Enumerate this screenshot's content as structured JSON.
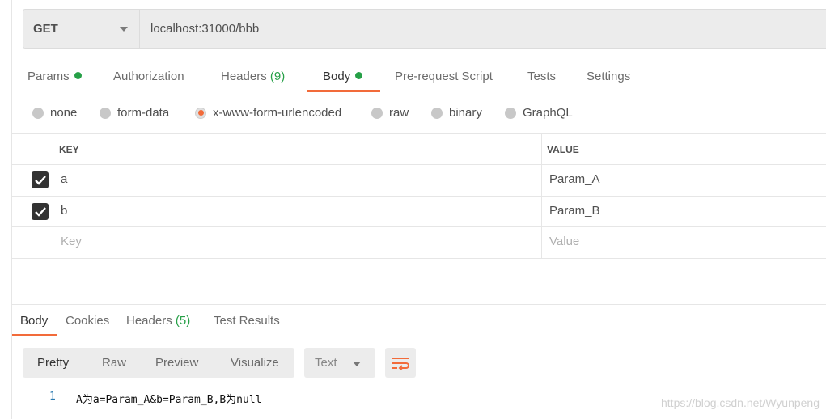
{
  "request": {
    "method": "GET",
    "url": "localhost:31000/bbb"
  },
  "tabs": [
    {
      "label": "Params",
      "dot": true
    },
    {
      "label": "Authorization"
    },
    {
      "label": "Headers",
      "count": "(9)"
    },
    {
      "label": "Body",
      "dot": true,
      "active": true
    },
    {
      "label": "Pre-request Script"
    },
    {
      "label": "Tests"
    },
    {
      "label": "Settings"
    }
  ],
  "body_types": [
    {
      "label": "none"
    },
    {
      "label": "form-data"
    },
    {
      "label": "x-www-form-urlencoded",
      "selected": true
    },
    {
      "label": "raw"
    },
    {
      "label": "binary"
    },
    {
      "label": "GraphQL"
    }
  ],
  "table": {
    "headers": {
      "key": "KEY",
      "value": "VALUE"
    },
    "rows": [
      {
        "checked": true,
        "key": "a",
        "value": "Param_A"
      },
      {
        "checked": true,
        "key": "b",
        "value": "Param_B"
      }
    ],
    "placeholder": {
      "key": "Key",
      "value": "Value"
    }
  },
  "response": {
    "tabs": [
      {
        "label": "Body",
        "active": true
      },
      {
        "label": "Cookies"
      },
      {
        "label": "Headers",
        "count": "(5)"
      },
      {
        "label": "Test Results"
      }
    ],
    "views": [
      "Pretty",
      "Raw",
      "Preview",
      "Visualize"
    ],
    "format": "Text",
    "lines": [
      {
        "num": "1",
        "text": "A为a=Param_A&b=Param_B,B为null"
      }
    ]
  },
  "watermark": "https://blog.csdn.net/Wyunpeng",
  "colors": {
    "accent": "#f26b3a",
    "green": "#26a047"
  }
}
